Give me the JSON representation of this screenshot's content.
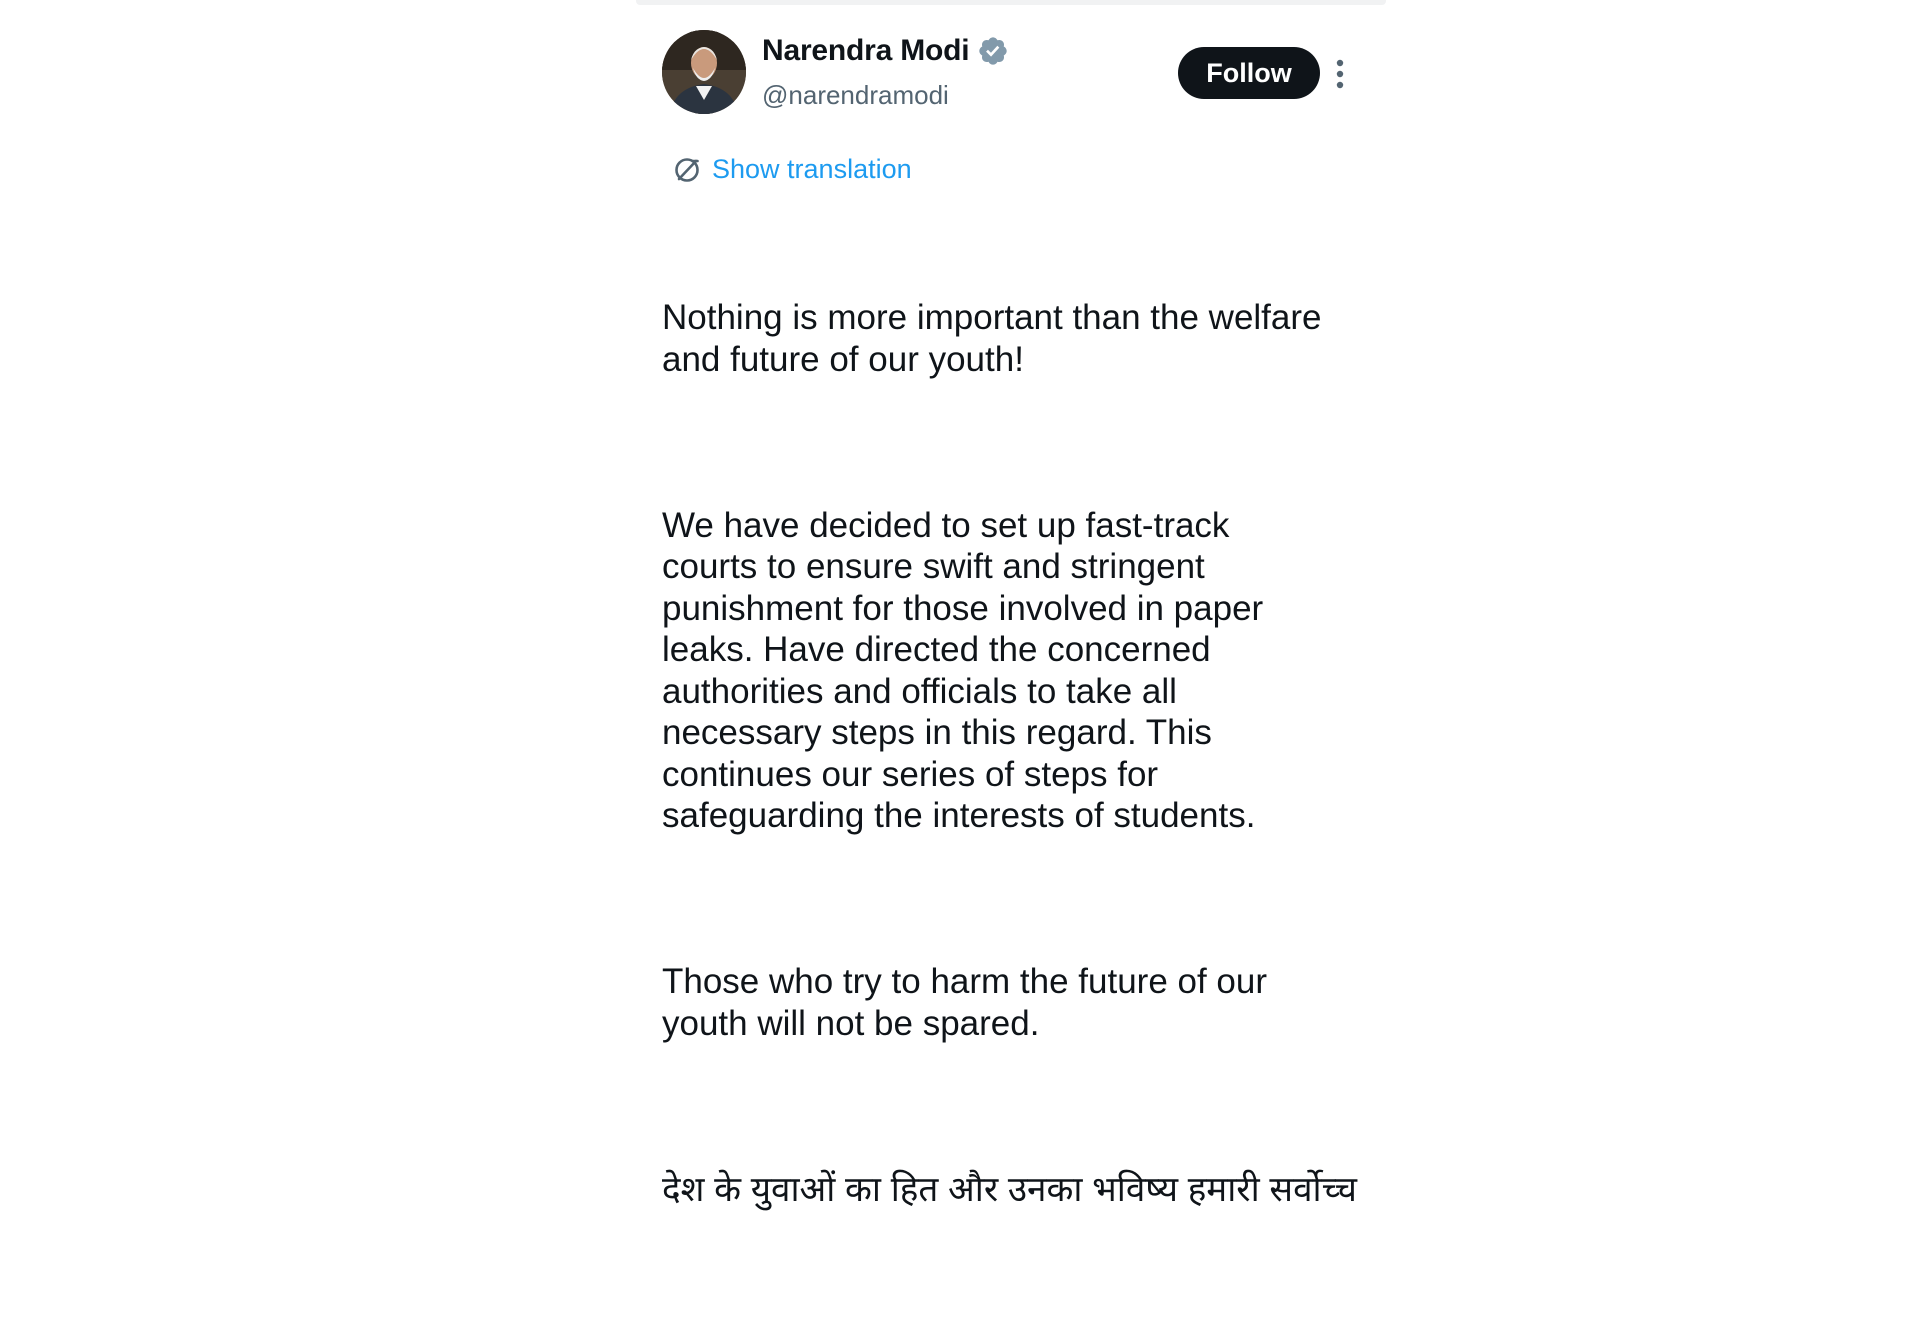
{
  "author": {
    "name": "Narendra Modi",
    "handle": "@narendramodi",
    "verified_icon": "verified-badge-icon",
    "avatar": "profile-photo"
  },
  "actions": {
    "follow_label": "Follow",
    "more_icon": "more-vertical-icon"
  },
  "translation": {
    "label": "Show translation",
    "icon": "translate-icon"
  },
  "tweet": {
    "paragraphs": [
      "Nothing is more important than the welfare\nand future of our youth!",
      "We have decided to set up fast-track\ncourts to ensure swift and stringent\npunishment for those involved in paper\nleaks. Have directed the concerned\nauthorities and officials to take all\nnecessary steps in this regard. This\ncontinues our series of steps for\nsafeguarding the interests of students.",
      "Those who try to harm the future of our\nyouth will not be spared.",
      "देश के युवाओं का हित और उनका भविष्य हमारी सर्वोच्च"
    ]
  },
  "colors": {
    "link": "#1d9bf0",
    "text": "#0f1419",
    "secondary": "#536471",
    "verified": "#829aab"
  }
}
